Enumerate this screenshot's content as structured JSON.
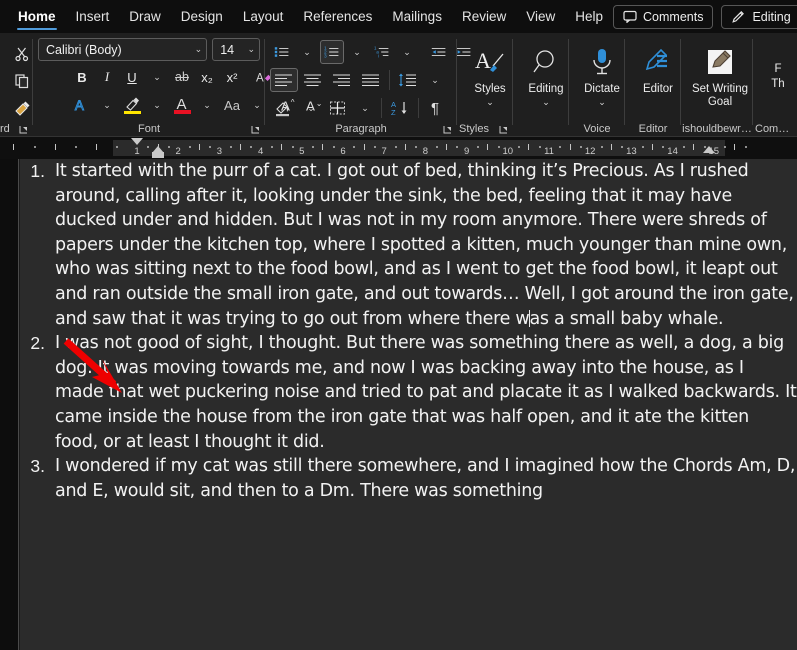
{
  "tabs": [
    {
      "label": "Home",
      "active": true
    },
    {
      "label": "Insert",
      "active": false
    },
    {
      "label": "Draw",
      "active": false
    },
    {
      "label": "Design",
      "active": false
    },
    {
      "label": "Layout",
      "active": false
    },
    {
      "label": "References",
      "active": false
    },
    {
      "label": "Mailings",
      "active": false
    },
    {
      "label": "Review",
      "active": false
    },
    {
      "label": "View",
      "active": false
    },
    {
      "label": "Help",
      "active": false
    }
  ],
  "tabstrip_right": {
    "comments_label": "Comments",
    "comments_icon": "comment-bubble-icon",
    "editing_label": "Editing",
    "editing_icon": "pencil-icon",
    "editing_caret": "⌄"
  },
  "ribbon": {
    "clipboard": {
      "group_label": "rd",
      "group_label_full": "Clipboard",
      "cut_icon": "scissors-icon",
      "copy_icon": "copy-icon",
      "format_painter_icon": "paintbrush-icon",
      "launcher_icon": "dialog-launcher-icon"
    },
    "font": {
      "group_label": "Font",
      "font_name": "Calibri (Body)",
      "font_size": "14",
      "bold": "B",
      "italic": "I",
      "underline": "U",
      "strikethrough": "ab",
      "subscript": "x₂",
      "superscript": "x²",
      "clear_formatting_icon": "clear-formatting-icon",
      "text_effects_icon": "text-effects-icon",
      "highlight_icon": "highlight-color-icon",
      "font_color_icon": "font-color-icon",
      "change_case": "Aa",
      "grow_font": "A",
      "shrink_font": "A",
      "caret": "⌄",
      "launcher_icon": "dialog-launcher-icon"
    },
    "paragraph": {
      "group_label": "Paragraph",
      "bullets_icon": "bulleted-list-icon",
      "numbering_icon": "numbered-list-icon",
      "numbering_active": true,
      "multilevel_icon": "multilevel-list-icon",
      "decrease_indent_icon": "decrease-indent-icon",
      "increase_indent_icon": "increase-indent-icon",
      "align_left_icon": "align-left-icon",
      "align_left_active": true,
      "align_center_icon": "align-center-icon",
      "align_right_icon": "align-right-icon",
      "justify_icon": "justify-icon",
      "line_spacing_icon": "line-spacing-icon",
      "shading_icon": "shading-icon",
      "borders_icon": "borders-icon",
      "sort_icon": "sort-icon",
      "show_marks_icon": "show-formatting-marks-icon",
      "caret": "⌄",
      "launcher_icon": "dialog-launcher-icon"
    },
    "styles": {
      "group_label": "Styles",
      "button_label": "Styles",
      "icon": "styles-icon",
      "caret": "⌄",
      "launcher_icon": "dialog-launcher-icon"
    },
    "editing_group": {
      "group_label": "",
      "button_label": "Editing",
      "icon": "magnifier-icon",
      "caret": "⌄"
    },
    "voice": {
      "group_label": "Voice",
      "button_label": "Dictate",
      "icon": "microphone-icon",
      "caret": "⌄"
    },
    "editor": {
      "group_label": "Editor",
      "button_label": "Editor",
      "icon": "editor-pen-icon"
    },
    "writing_goal": {
      "group_label": "ishouldbewr…",
      "button_label": "Set Writing Goal",
      "icon": "set-writing-goal-icon"
    },
    "comments_group": {
      "group_label": "Com…",
      "button_label_line1": "F",
      "button_label_line2": "Th"
    }
  },
  "ruler": {
    "numbers": [
      "1",
      "2",
      "3",
      "4",
      "5",
      "6",
      "7",
      "8",
      "9",
      "10",
      "11",
      "12",
      "13",
      "14",
      "15"
    ],
    "first_line_indent_marker": "first-line-indent",
    "hanging_indent_marker": "hanging-indent",
    "left_indent_marker": "left-indent",
    "right_indent_marker": "right-indent"
  },
  "document": {
    "list_items": [
      {
        "number": "1.",
        "text_before_caret": "It started with the purr of a cat. I got out of bed, thinking it’s Precious. As I rushed around, calling after it, looking under the sink, the bed, feeling that it may have ducked under and hidden. But I was not in my room anymore. There were shreds of papers under the kitchen top, where I spotted a kitten, much younger than mine own, who was sitting next to the food bowl, and as I went to get the food bowl, it leapt out and ran outside the small iron gate, and out towards… Well, I got around the iron gate, and saw that it was trying to go out from where there w",
        "text_after_caret": "as a small baby whale.",
        "has_caret": true
      },
      {
        "number": "2.",
        "text_before_caret": "I was not good of sight, I thought. But there was something there as well, a dog, a big dog. It was moving towards me, and now I was backing away into the house, as I made that wet puckering noise and tried to pat and placate it as I walked backwards. It came inside the house from the iron gate that was half open, and it ate the kitten food, or at least I thought it did.",
        "text_after_caret": "",
        "has_caret": false
      },
      {
        "number": "3.",
        "text_before_caret": "I wondered if my cat was still there somewhere, and I imagined how the Chords Am, D, and E, would sit, and then to a Dm. There was something",
        "text_after_caret": "",
        "has_caret": false
      }
    ]
  },
  "annotation": {
    "arrow_icon": "red-arrow-pointer",
    "arrow_color": "#ee0000"
  },
  "colors": {
    "accent": "#4f9ad9",
    "tabstrip_bg": "#0e0e0e",
    "ribbon_bg": "#1f1f1f",
    "page_bg": "#2b2b2b",
    "text": "#f2f2f2",
    "highlight_yellow": "#ffe500",
    "font_color_red": "#e81123"
  }
}
